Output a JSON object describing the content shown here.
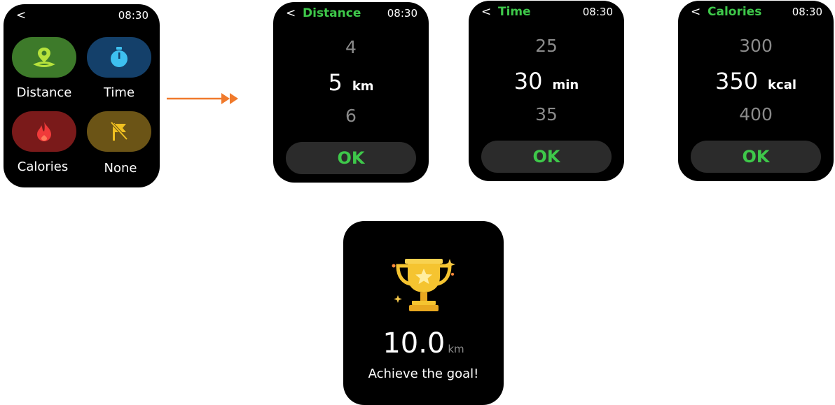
{
  "menu_screen": {
    "back": "<",
    "time": "08:30",
    "options": [
      {
        "label": "Distance",
        "icon": "location-pin-icon",
        "color": "#3d7a2a"
      },
      {
        "label": "Time",
        "icon": "stopwatch-icon",
        "color": "#14406a"
      },
      {
        "label": "Calories",
        "icon": "flame-icon",
        "color": "#7a1a1a"
      },
      {
        "label": "None",
        "icon": "flag-off-icon",
        "color": "#6b5416"
      }
    ]
  },
  "distance_screen": {
    "back": "<",
    "title": "Distance",
    "time": "08:30",
    "prev": "4",
    "selected": "5",
    "unit": "km",
    "next": "6",
    "ok": "OK"
  },
  "time_screen": {
    "back": "<",
    "title": "Time",
    "time": "08:30",
    "prev": "25",
    "selected": "30",
    "unit": "min",
    "next": "35",
    "ok": "OK"
  },
  "calories_screen": {
    "back": "<",
    "title": "Calories",
    "time": "08:30",
    "prev": "300",
    "selected": "350",
    "unit": "kcal",
    "next": "400",
    "ok": "OK"
  },
  "goal_screen": {
    "value": "10.0",
    "unit": "km",
    "message": "Achieve the goal!",
    "icon": "trophy-icon"
  },
  "accent_color": "#3ec84a",
  "arrow_color": "#f07a2c"
}
